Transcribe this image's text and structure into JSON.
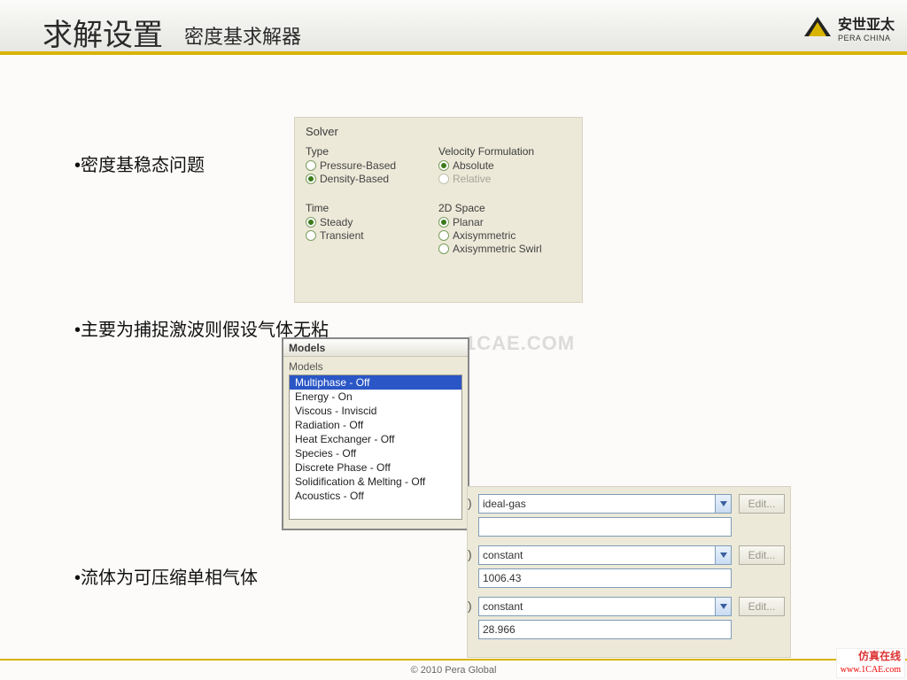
{
  "header": {
    "title_main": "求解设置",
    "title_sub": "密度基求解器",
    "logo_cn": "安世亚太",
    "logo_en": "PERA CHINA"
  },
  "bullets": {
    "b1": "•密度基稳态问题",
    "b2": "•主要为捕捉激波则假设气体无粘",
    "b3": "•流体为可压缩单相气体"
  },
  "solver": {
    "panel_title": "Solver",
    "type": {
      "label": "Type",
      "options": [
        "Pressure-Based",
        "Density-Based"
      ],
      "selected": 1
    },
    "velocity": {
      "label": "Velocity Formulation",
      "options": [
        "Absolute",
        "Relative"
      ],
      "selected": 0,
      "disabled_index": 1
    },
    "time": {
      "label": "Time",
      "options": [
        "Steady",
        "Transient"
      ],
      "selected": 0
    },
    "space": {
      "label": "2D Space",
      "options": [
        "Planar",
        "Axisymmetric",
        "Axisymmetric Swirl"
      ],
      "selected": 0
    }
  },
  "models": {
    "title": "Models",
    "group_label": "Models",
    "items": [
      "Multiphase - Off",
      "Energy - On",
      "Viscous - Inviscid",
      "Radiation - Off",
      "Heat Exchanger - Off",
      "Species - Off",
      "Discrete Phase - Off",
      "Solidification & Melting - Off",
      "Acoustics - Off"
    ],
    "selected_index": 0
  },
  "properties": {
    "edit_label": "Edit...",
    "rows": [
      {
        "combo_value": "ideal-gas",
        "numeric_value": ""
      },
      {
        "combo_value": "constant",
        "numeric_value": "1006.43"
      },
      {
        "combo_value": "constant",
        "numeric_value": "28.966"
      }
    ]
  },
  "watermark": "1CAE.COM",
  "footer": "© 2010 Pera Global",
  "corner": {
    "cn": "仿真在线",
    "url": "www.1CAE.com"
  }
}
